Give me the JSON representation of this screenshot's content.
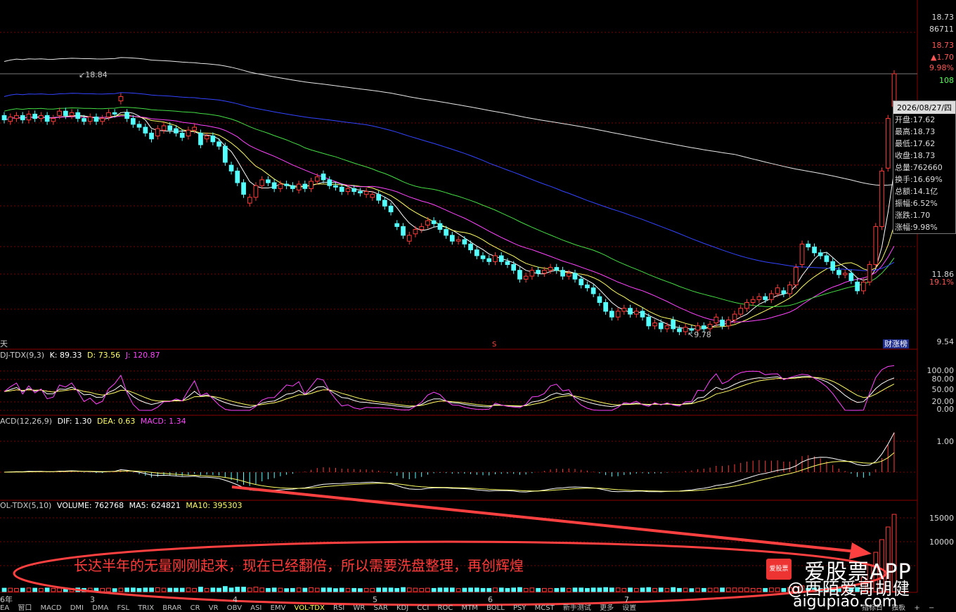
{
  "main_panel": {
    "high_marker": "18.84",
    "low_marker": "9.78",
    "period_label": "天",
    "right_axis": [
      "18.73",
      "86711",
      "18.73",
      "▲1.70",
      "9.98%",
      "108",
      "11.86",
      "19.1%",
      "9.54"
    ],
    "badge": "财涨榜",
    "s_marker": "S"
  },
  "info_box": {
    "date": "2026/08/27/四",
    "rows": [
      "开盘:17.62",
      "最高:18.73",
      "最低:17.62",
      "收盘:18.73",
      "总量:762660",
      "换手:16.69%",
      "总额:14.1亿",
      "振幅:6.52%",
      "涨跌:1.70",
      "涨幅:9.98%"
    ]
  },
  "kdj_panel": {
    "title": "DJ-TDX(9,3)",
    "k": "K: 89.33",
    "d": "D: 73.56",
    "j": "J: 120.87",
    "axis": [
      "100.00",
      "80.00",
      "50.00",
      "20.00",
      "0.00"
    ]
  },
  "macd_panel": {
    "title": "ACD(12,26,9)",
    "dif": "DIF: 1.30",
    "dea": "DEA: 0.63",
    "macd": "MACD: 1.34",
    "axis": [
      "1.00"
    ]
  },
  "vol_panel": {
    "title": "OL-TDX(5,10)",
    "volume": "VOLUME: 762768",
    "ma5": "MA5: 624821",
    "ma10": "MA10: 395303",
    "axis": [
      "15000",
      "10000"
    ]
  },
  "x_axis": [
    "6年",
    "3",
    "4",
    "5",
    "6",
    "7"
  ],
  "tabs": [
    "EA",
    "窗口",
    "MACD",
    "DMI",
    "DMA",
    "FSL",
    "TRIX",
    "BRAR",
    "CR",
    "VR",
    "OBV",
    "ASI",
    "EMV",
    "VOL-TDX",
    "RSI",
    "WR",
    "SAR",
    "KDJ",
    "CCI",
    "ROC",
    "MTM",
    "BOLL",
    "PSY",
    "MCST",
    "新手测试",
    "更多",
    "设置"
  ],
  "tabs_right": [
    "指标日",
    "独板",
    "+",
    "−"
  ],
  "annotation": "长达半年的无量刚刚起来，现在已经翻倍，所以需要洗盘整理，再创辉煌",
  "watermark_logo": "爱股票",
  "watermark_app": "爱股票APP",
  "watermark_weibo": "@西陌爱哥胡健",
  "watermark_url": "aigupiao.com",
  "colors": {
    "up": "#ff3b3b",
    "down": "#54ffff",
    "ma5": "#ffffff",
    "ma10": "#ffff66",
    "ma20": "#ff44ff",
    "ma30": "#44dd44",
    "ma60": "#3344ff",
    "ma120": "#e8e8e8",
    "grid": "#7a0000"
  },
  "chart_data": {
    "type": "candlestick",
    "price_axis": [
      9.54,
      11.86,
      18.73
    ],
    "points": [
      {
        "o": 17.3,
        "c": 17.15
      },
      {
        "o": 17.1,
        "c": 17.25
      },
      {
        "o": 17.2,
        "c": 17.3
      },
      {
        "o": 17.3,
        "c": 17.15
      },
      {
        "o": 17.15,
        "c": 17.35
      },
      {
        "o": 17.35,
        "c": 17.2
      },
      {
        "o": 17.2,
        "c": 17.3
      },
      {
        "o": 17.3,
        "c": 17.1
      },
      {
        "o": 17.1,
        "c": 17.2
      },
      {
        "o": 17.3,
        "c": 17.45
      },
      {
        "o": 17.45,
        "c": 17.3
      },
      {
        "o": 17.3,
        "c": 17.4
      },
      {
        "o": 17.4,
        "c": 17.2
      },
      {
        "o": 17.2,
        "c": 17.1
      },
      {
        "o": 17.1,
        "c": 17.25
      },
      {
        "o": 17.25,
        "c": 17.1
      },
      {
        "o": 17.1,
        "c": 17.2
      },
      {
        "o": 17.25,
        "c": 17.4
      },
      {
        "o": 17.4,
        "c": 17.35
      },
      {
        "o": 17.8,
        "c": 17.95
      },
      {
        "o": 17.4,
        "c": 17.2
      },
      {
        "o": 17.2,
        "c": 17.0
      },
      {
        "o": 17.0,
        "c": 16.9
      },
      {
        "o": 16.9,
        "c": 16.7
      },
      {
        "o": 16.7,
        "c": 16.5
      },
      {
        "o": 16.6,
        "c": 16.85
      },
      {
        "o": 16.8,
        "c": 16.95
      },
      {
        "o": 16.95,
        "c": 16.8
      },
      {
        "o": 16.85,
        "c": 16.7
      },
      {
        "o": 16.7,
        "c": 16.55
      },
      {
        "o": 16.6,
        "c": 16.8
      },
      {
        "o": 16.8,
        "c": 16.9
      },
      {
        "o": 16.7,
        "c": 16.3
      },
      {
        "o": 16.5,
        "c": 16.6
      },
      {
        "o": 16.6,
        "c": 16.4
      },
      {
        "o": 16.4,
        "c": 16.25
      },
      {
        "o": 16.25,
        "c": 15.7
      },
      {
        "o": 15.6,
        "c": 15.4
      },
      {
        "o": 15.4,
        "c": 15.0
      },
      {
        "o": 15.0,
        "c": 14.6
      },
      {
        "o": 14.3,
        "c": 14.5
      },
      {
        "o": 14.5,
        "c": 14.9
      },
      {
        "o": 14.9,
        "c": 15.1
      },
      {
        "o": 15.1,
        "c": 15.0
      },
      {
        "o": 15.0,
        "c": 14.8
      },
      {
        "o": 14.8,
        "c": 14.95
      },
      {
        "o": 14.95,
        "c": 14.9
      },
      {
        "o": 14.9,
        "c": 14.8
      },
      {
        "o": 14.75,
        "c": 14.95
      },
      {
        "o": 14.95,
        "c": 14.8
      },
      {
        "o": 14.8,
        "c": 15.05
      },
      {
        "o": 15.05,
        "c": 15.2
      },
      {
        "o": 15.3,
        "c": 15.1
      },
      {
        "o": 15.1,
        "c": 14.9
      },
      {
        "o": 14.9,
        "c": 14.85
      },
      {
        "o": 14.85,
        "c": 14.7
      },
      {
        "o": 14.7,
        "c": 14.8
      },
      {
        "o": 14.8,
        "c": 14.7
      },
      {
        "o": 14.7,
        "c": 14.65
      },
      {
        "o": 14.6,
        "c": 14.7
      },
      {
        "o": 14.5,
        "c": 14.6
      },
      {
        "o": 14.6,
        "c": 14.4
      },
      {
        "o": 14.4,
        "c": 14.2
      },
      {
        "o": 14.2,
        "c": 14.0
      },
      {
        "o": 13.6,
        "c": 13.5
      },
      {
        "o": 13.5,
        "c": 13.2
      },
      {
        "o": 13.0,
        "c": 13.2
      },
      {
        "o": 13.25,
        "c": 13.4
      },
      {
        "o": 13.4,
        "c": 13.5
      },
      {
        "o": 13.55,
        "c": 13.7
      },
      {
        "o": 13.7,
        "c": 13.6
      },
      {
        "o": 13.6,
        "c": 13.4
      },
      {
        "o": 13.4,
        "c": 13.2
      },
      {
        "o": 13.2,
        "c": 13.0
      },
      {
        "o": 13.0,
        "c": 13.05
      },
      {
        "o": 13.05,
        "c": 12.9
      },
      {
        "o": 12.9,
        "c": 12.7
      },
      {
        "o": 12.7,
        "c": 12.5
      },
      {
        "o": 12.5,
        "c": 12.4
      },
      {
        "o": 12.4,
        "c": 12.3
      },
      {
        "o": 12.3,
        "c": 12.5
      },
      {
        "o": 12.5,
        "c": 12.3
      },
      {
        "o": 12.3,
        "c": 12.2
      },
      {
        "o": 12.2,
        "c": 12.0
      },
      {
        "o": 12.0,
        "c": 11.7
      },
      {
        "o": 11.7,
        "c": 11.8
      },
      {
        "o": 11.8,
        "c": 12.0
      },
      {
        "o": 12.0,
        "c": 11.9
      },
      {
        "o": 11.9,
        "c": 12.0
      },
      {
        "o": 12.0,
        "c": 12.1
      },
      {
        "o": 12.1,
        "c": 12.0
      },
      {
        "o": 12.0,
        "c": 11.8
      },
      {
        "o": 11.8,
        "c": 11.9
      },
      {
        "o": 11.9,
        "c": 11.7
      },
      {
        "o": 11.7,
        "c": 11.5
      },
      {
        "o": 11.5,
        "c": 11.4
      },
      {
        "o": 11.4,
        "c": 11.2
      },
      {
        "o": 11.1,
        "c": 10.9
      },
      {
        "o": 10.9,
        "c": 10.6
      },
      {
        "o": 10.6,
        "c": 10.4
      },
      {
        "o": 10.4,
        "c": 10.6
      },
      {
        "o": 10.6,
        "c": 10.7
      },
      {
        "o": 10.7,
        "c": 10.5
      },
      {
        "o": 10.5,
        "c": 10.6
      },
      {
        "o": 10.6,
        "c": 10.4
      },
      {
        "o": 10.4,
        "c": 10.1
      },
      {
        "o": 10.1,
        "c": 10.2
      },
      {
        "o": 10.2,
        "c": 10.0
      },
      {
        "o": 10.0,
        "c": 10.1
      },
      {
        "o": 10.3,
        "c": 10.0
      },
      {
        "o": 10.0,
        "c": 9.9
      },
      {
        "o": 9.9,
        "c": 10.05
      },
      {
        "o": 10.0,
        "c": 9.95
      },
      {
        "o": 9.95,
        "c": 10.1
      },
      {
        "o": 10.1,
        "c": 10.0
      },
      {
        "o": 10.0,
        "c": 10.15
      },
      {
        "o": 10.2,
        "c": 10.4
      },
      {
        "o": 10.3,
        "c": 10.1
      },
      {
        "o": 10.1,
        "c": 10.3
      },
      {
        "o": 10.3,
        "c": 10.5
      },
      {
        "o": 10.5,
        "c": 10.7
      },
      {
        "o": 10.7,
        "c": 10.9
      },
      {
        "o": 10.9,
        "c": 11.0
      },
      {
        "o": 11.0,
        "c": 11.1
      },
      {
        "o": 11.1,
        "c": 11.0
      },
      {
        "o": 11.0,
        "c": 11.2
      },
      {
        "o": 11.2,
        "c": 11.4
      },
      {
        "o": 11.3,
        "c": 11.2
      },
      {
        "o": 11.2,
        "c": 11.5
      },
      {
        "o": 11.5,
        "c": 12.1
      },
      {
        "o": 12.2,
        "c": 12.9
      },
      {
        "o": 12.9,
        "c": 12.8
      },
      {
        "o": 12.8,
        "c": 12.6
      },
      {
        "o": 12.6,
        "c": 12.5
      },
      {
        "o": 12.5,
        "c": 12.3
      },
      {
        "o": 12.3,
        "c": 12.0
      },
      {
        "o": 12.0,
        "c": 11.85
      },
      {
        "o": 11.85,
        "c": 11.9
      },
      {
        "o": 11.9,
        "c": 11.65
      },
      {
        "o": 11.6,
        "c": 11.3
      },
      {
        "o": 11.3,
        "c": 11.6
      },
      {
        "o": 11.6,
        "c": 12.2
      },
      {
        "o": 12.2,
        "c": 13.5
      },
      {
        "o": 13.5,
        "c": 15.4
      },
      {
        "o": 15.5,
        "c": 17.2
      },
      {
        "o": 17.62,
        "c": 18.73
      }
    ]
  }
}
